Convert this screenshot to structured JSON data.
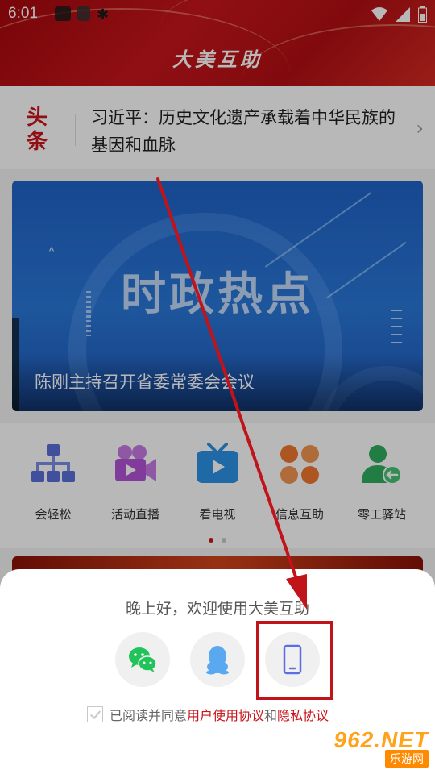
{
  "status_bar": {
    "time": "6:01"
  },
  "header": {
    "title": "大美互助"
  },
  "headline": {
    "tag": "头条",
    "text": "习近平：历史文化遗产承载着中华民族的基因和血脉"
  },
  "banner": {
    "title": "时政热点",
    "caption": "陈刚主持召开省委常委会会议"
  },
  "quick_menu": {
    "items": [
      {
        "label": "会轻松",
        "icon": "org-chart-icon",
        "color": "#5a6fd8"
      },
      {
        "label": "活动直播",
        "icon": "video-camera-icon",
        "color": "#b353d6"
      },
      {
        "label": "看电视",
        "icon": "tv-icon",
        "color": "#2b93e6"
      },
      {
        "label": "信息互助",
        "icon": "clover-icon",
        "color": "#f07830"
      },
      {
        "label": "零工驿站",
        "icon": "user-exchange-icon",
        "color": "#2fae5e"
      }
    ],
    "page_dots": 2,
    "active_page": 1
  },
  "login_sheet": {
    "greeting": "晚上好，欢迎使用大美互助",
    "options": [
      {
        "name": "wechat-login",
        "icon": "wechat-icon",
        "color": "#22c35a"
      },
      {
        "name": "qq-login",
        "icon": "qq-icon",
        "color": "#5aa8f0"
      },
      {
        "name": "phone-login",
        "icon": "phone-icon",
        "color": "#5b6ee3"
      }
    ],
    "agreement": {
      "prefix": "已阅读并同意",
      "user_agreement": "用户使用协议",
      "conjunction": "和",
      "privacy_policy": "隐私协议"
    }
  },
  "watermark": {
    "top": "962.NET",
    "bottom": "乐游网"
  },
  "colors": {
    "brand_red": "#c8161c",
    "annotation_red": "#c0131a"
  }
}
